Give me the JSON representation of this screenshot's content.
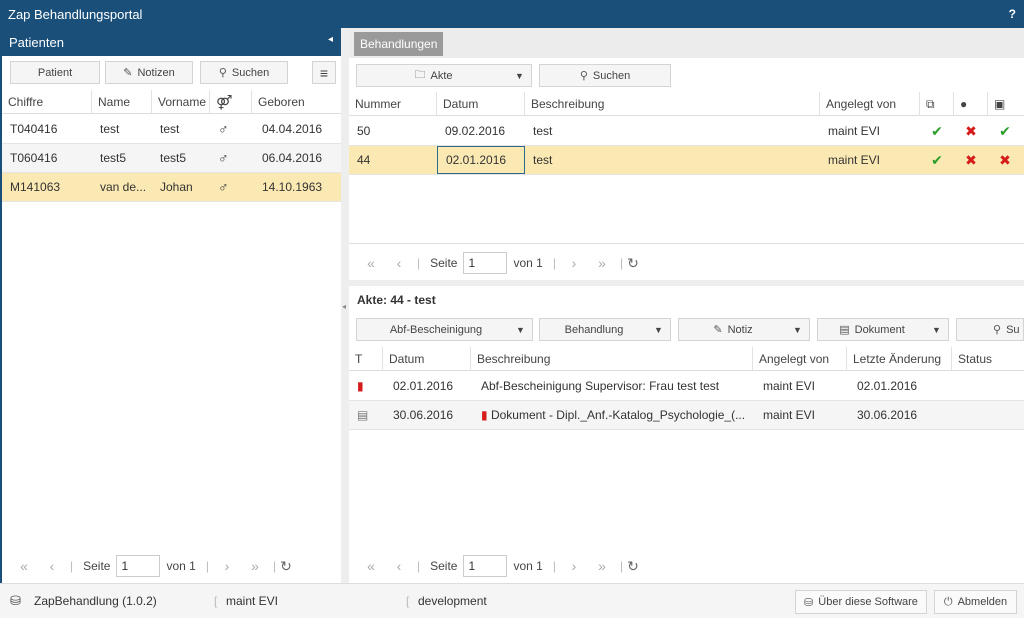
{
  "app": {
    "title": "Zap Behandlungsportal",
    "help": "?"
  },
  "left": {
    "title": "Patienten",
    "toolbar": {
      "patient": "Patient",
      "notes": "Notizen",
      "search": "Suchen"
    },
    "columns": [
      "Chiffre",
      "Name",
      "Vorname",
      "⚤",
      "Geboren"
    ],
    "rows": [
      {
        "chiffre": "T040416",
        "name": "test",
        "vorname": "test",
        "sex": "♂",
        "geboren": "04.04.2016"
      },
      {
        "chiffre": "T060416",
        "name": "test5",
        "vorname": "test5",
        "sex": "♂",
        "geboren": "06.04.2016"
      },
      {
        "chiffre": "M141063",
        "name": "van de...",
        "vorname": "Johan",
        "sex": "♂",
        "geboren": "14.10.1963"
      }
    ],
    "pager": {
      "page_label": "Seite",
      "page": "1",
      "of": "von 1"
    }
  },
  "right": {
    "tab": "Behandlungen",
    "toolbar": {
      "akte": "Akte",
      "search": "Suchen"
    },
    "columns": [
      "Nummer",
      "Datum",
      "Beschreibung",
      "Angelegt von"
    ],
    "rows": [
      {
        "nummer": "50",
        "datum": "09.02.2016",
        "beschreibung": "test",
        "angelegt": "maint EVI",
        "c1": "✔",
        "c2": "✖",
        "c3": "✔"
      },
      {
        "nummer": "44",
        "datum": "02.01.2016",
        "beschreibung": "test",
        "angelegt": "maint EVI",
        "c1": "✔",
        "c2": "✖",
        "c3": "✖"
      }
    ],
    "pager": {
      "page_label": "Seite",
      "page": "1",
      "of": "von 1"
    },
    "akte_title": "Akte: 44 - test",
    "akte_toolbar": {
      "abf": "Abf-Bescheinigung",
      "behandlung": "Behandlung",
      "notiz": "Notiz",
      "dokument": "Dokument",
      "search": "Su"
    },
    "akte_columns": [
      "T",
      "Datum",
      "Beschreibung",
      "Angelegt von",
      "Letzte Änderung",
      "Status"
    ],
    "akte_rows": [
      {
        "datum": "02.01.2016",
        "beschreibung": "Abf-Bescheinigung Supervisor: Frau test test",
        "angelegt": "maint EVI",
        "geaendert": "02.01.2016"
      },
      {
        "datum": "30.06.2016",
        "beschreibung": "Dokument - Dipl._Anf.-Katalog_Psychologie_(...",
        "angelegt": "maint EVI",
        "geaendert": "30.06.2016"
      }
    ],
    "akte_pager": {
      "page_label": "Seite",
      "page": "1",
      "of": "von 1"
    }
  },
  "statusbar": {
    "app_version": "ZapBehandlung (1.0.2)",
    "user": "maint EVI",
    "env": "development",
    "about": "Über diese Software",
    "logout": "Abmelden"
  },
  "colors": {
    "header": "#1a4f7a",
    "selected": "#fbe9b3",
    "check": "#2a9d2a",
    "cross": "#d61b1b"
  }
}
